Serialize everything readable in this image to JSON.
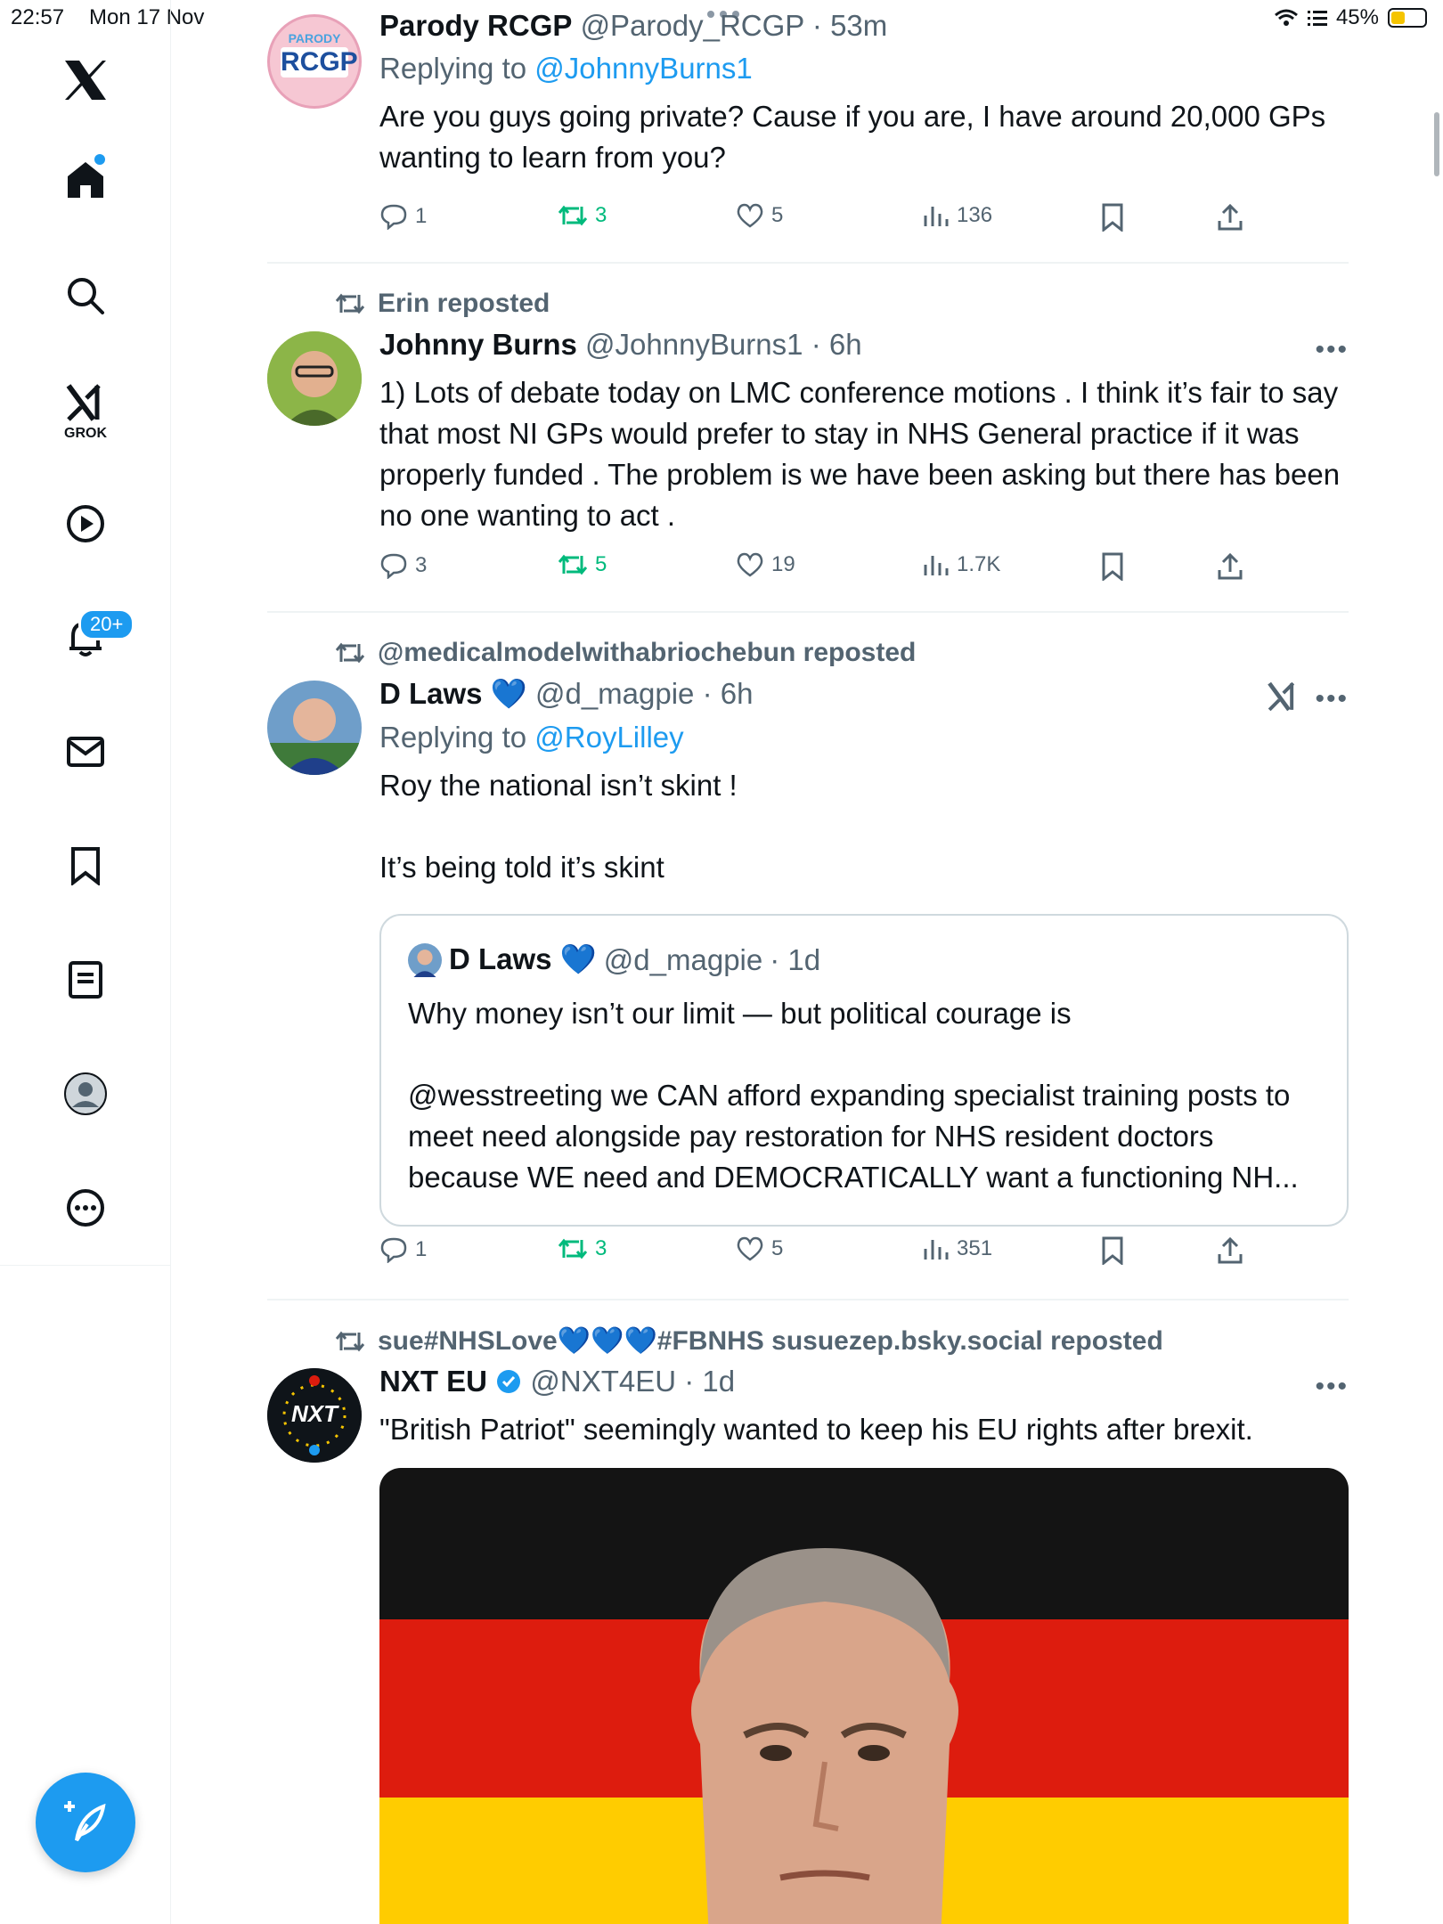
{
  "status_bar": {
    "time": "22:57",
    "date": "Mon 17 Nov",
    "battery": "45%",
    "battery_level": 0.45
  },
  "sidebar": {
    "grok_label": "GROK",
    "notifications_badge": "20+",
    "icons": [
      "x-logo-icon",
      "home-icon",
      "search-icon",
      "grok-icon",
      "video-icon",
      "bell-icon",
      "mail-icon",
      "bookmark-icon",
      "list-icon",
      "profile-icon",
      "more-icon",
      "compose-icon"
    ]
  },
  "tweets": [
    {
      "name": "Parody RCGP",
      "handle": "@Parody_RCGP",
      "time": "· 53m",
      "replying_prefix": "Replying to ",
      "replying_to": "@JohnnyBurns1",
      "text": "Are you guys going private? Cause if you are, I have around 20,000 GPs wanting to learn from you?",
      "avatar_text_top": "PARODY",
      "avatar_text_main": "RCGP",
      "replies": "1",
      "reposts": "3",
      "likes": "5",
      "views": "136"
    },
    {
      "reposted_by": "Erin reposted",
      "name": "Johnny Burns",
      "handle": "@JohnnyBurns1",
      "time": "· 6h",
      "text": "1) Lots of debate today on LMC conference motions . I think it’s fair to say that most NI GPs would prefer to stay in NHS General practice if it was properly funded . The problem is we have been asking but there has been no one wanting to act .",
      "replies": "3",
      "reposts": "5",
      "likes": "19",
      "views": "1.7K"
    },
    {
      "reposted_by": "@medicalmodelwithabriochebun reposted",
      "name": "D Laws 💙",
      "handle": "@d_magpie",
      "time": "· 6h",
      "replying_prefix": "Replying to ",
      "replying_to": "@RoyLilley",
      "text": "Roy the national isn’t skint !\n\nIt’s being told it’s skint",
      "quote": {
        "name": "D Laws 💙",
        "handle": "@d_magpie",
        "time": "· 1d",
        "text": "Why money isn’t our limit — but political courage is\n\n@wesstreeting we CAN afford expanding specialist training posts to meet need alongside pay restoration for NHS resident doctors because WE need and DEMOCRATICALLY want a functioning NH..."
      },
      "replies": "1",
      "reposts": "3",
      "likes": "5",
      "views": "351"
    },
    {
      "reposted_by": "sue#NHSLove💙💙💙#FBNHS susuezep.bsky.social reposted",
      "name": "NXT EU",
      "handle": "@NXT4EU",
      "time": "· 1d",
      "text": "\"British Patriot\" seemingly wanted to keep his EU rights after brexit.",
      "avatar_text_main": "NXT"
    }
  ],
  "colors": {
    "accent": "#1d9bf0",
    "repost_green": "#00ba7c",
    "muted": "#536471",
    "text": "#0f1419"
  }
}
